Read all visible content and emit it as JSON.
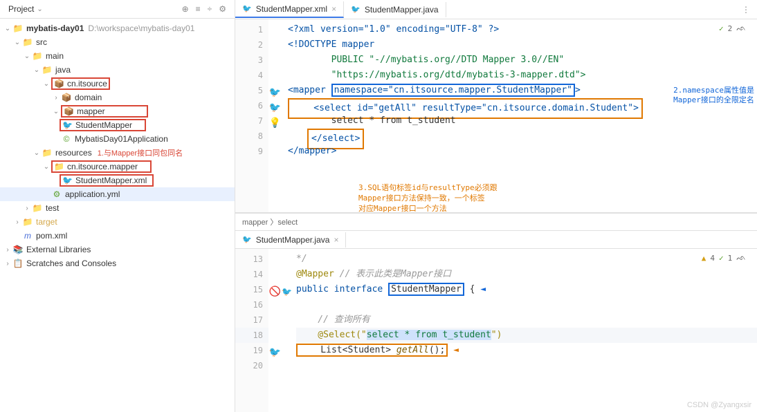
{
  "sidebar": {
    "title": "Project",
    "root": {
      "label": "mybatis-day01",
      "path": "D:\\workspace\\mybatis-day01"
    },
    "nodes": {
      "src": "src",
      "main": "main",
      "java": "java",
      "cnitsource": "cn.itsource",
      "domain": "domain",
      "mapper": "mapper",
      "studentmapper": "StudentMapper",
      "app": "MybatisDay01Application",
      "resources": "resources",
      "mapperpkg": "cn.itsource.mapper",
      "studentmapperxml": "StudentMapper.xml",
      "appyml": "application.yml",
      "test": "test",
      "target": "target",
      "pom": "pom.xml",
      "extlib": "External Libraries",
      "scratches": "Scratches and Consoles"
    },
    "annotation1": "1.与Mapper接口同包同名"
  },
  "tabs": {
    "xml": "StudentMapper.xml",
    "java": "StudentMapper.java"
  },
  "xml_code": {
    "l1": "<?xml version=\"1.0\" encoding=\"UTF-8\" ?>",
    "l2": "<!DOCTYPE mapper",
    "l3": "        PUBLIC \"-//mybatis.org//DTD Mapper 3.0//EN\"",
    "l4": "        \"https://mybatis.org/dtd/mybatis-3-mapper.dtd\">",
    "l5a": "<mapper ",
    "l5b": "namespace=\"cn.itsource.mapper.StudentMapper\"",
    "l5c": ">",
    "l6": "    <select id=\"getAll\" resultType=\"cn.itsource.domain.Student\">",
    "l7": "        select * from t_student",
    "l8": "    </select>",
    "l9": "</mapper>",
    "indicator": "2",
    "anno2_a": "2.namespace属性值是",
    "anno2_b": "Mapper接口的全限定名",
    "anno3_a": "3.SQL语句标签id与resultType必须跟",
    "anno3_b": "Mapper接口方法保持一致，一个标签",
    "anno3_c": "对应Mapper接口一个方法"
  },
  "breadcrumb": "mapper 〉select",
  "java_code": {
    "l13": "*/",
    "l14a": "@Mapper",
    "l14b": " // 表示此类是Mapper接口",
    "l15a": "public interface ",
    "l15b": "StudentMapper",
    "l15c": " {",
    "l17": "    // 查询所有",
    "l18a": "    @Select(\"",
    "l18b": "select * from t_student",
    "l18c": "\")",
    "l19a": "    List<Student> ",
    "l19b": "getAll",
    "l19c": "();",
    "ind_warn": "4",
    "ind_ok": "1"
  },
  "watermark": "CSDN @Zyangxsir"
}
